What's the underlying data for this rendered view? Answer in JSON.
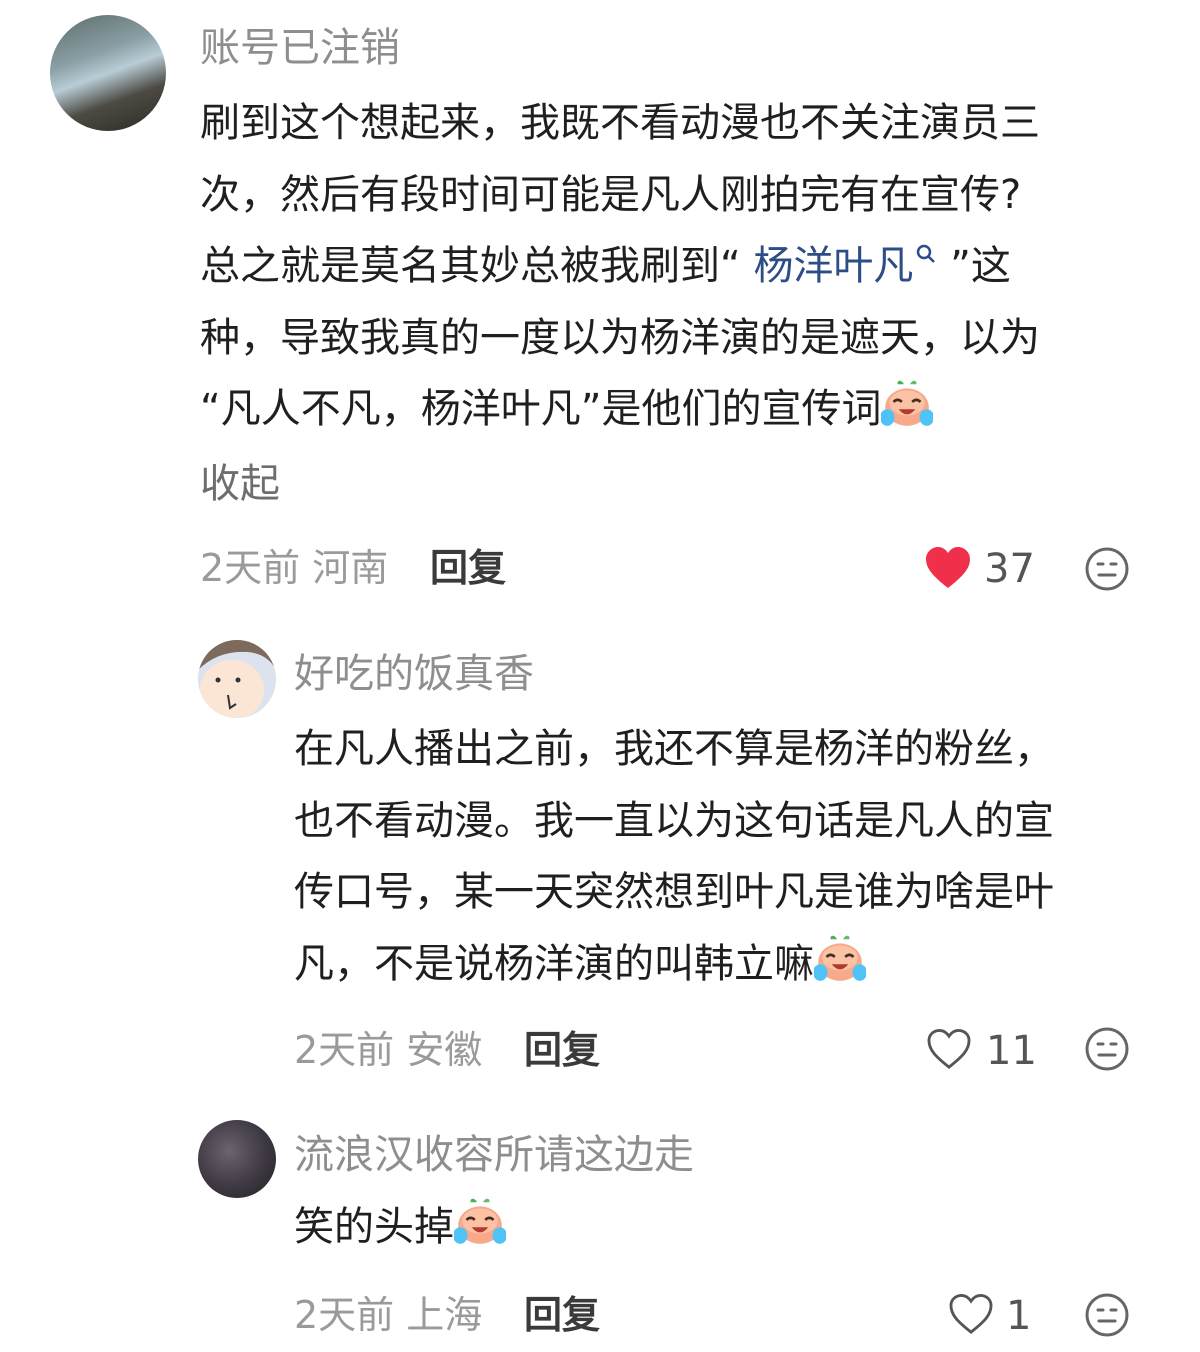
{
  "comments": [
    {
      "username": "账号已注销",
      "lines": [
        "刷到这个想起来，我既不看动漫也不关注演员三",
        "次，然后有段时间可能是凡人刚拍完有在宣传?"
      ],
      "line3_before": "总之就是莫名其妙总被我刷到“ ",
      "line3_link": "杨洋叶凡",
      "line3_after": " ”这",
      "line4": "种，导致我真的一度以为杨洋演的是遮天，以为",
      "line5": "“凡人不凡，杨洋叶凡”是他们的宣传词",
      "collapse_label": "收起",
      "time": "2天前",
      "location": "河南",
      "reply_label": "回复",
      "likes": "37",
      "liked": true
    },
    {
      "username": "好吃的饭真香",
      "lines": [
        "在凡人播出之前，我还不算是杨洋的粉丝，",
        "也不看动漫。我一直以为这句话是凡人的宣",
        "传口号，某一天突然想到叶凡是谁为啥是叶"
      ],
      "last_line": "凡，不是说杨洋演的叫韩立嘛",
      "time": "2天前",
      "location": "安徽",
      "reply_label": "回复",
      "likes": "11",
      "liked": false
    },
    {
      "username": "流浪汉收容所请这边走",
      "text": "笑的头掉",
      "time": "2天前",
      "location": "上海",
      "reply_label": "回复",
      "likes": "1",
      "liked": false
    }
  ],
  "colors": {
    "like_red": "#f0304a",
    "link_blue": "#2c4d85",
    "meta_gray": "#9a9a9a"
  },
  "icons": [
    "heart-icon",
    "dislike-face-icon",
    "crying-emoji",
    "search-icon"
  ]
}
